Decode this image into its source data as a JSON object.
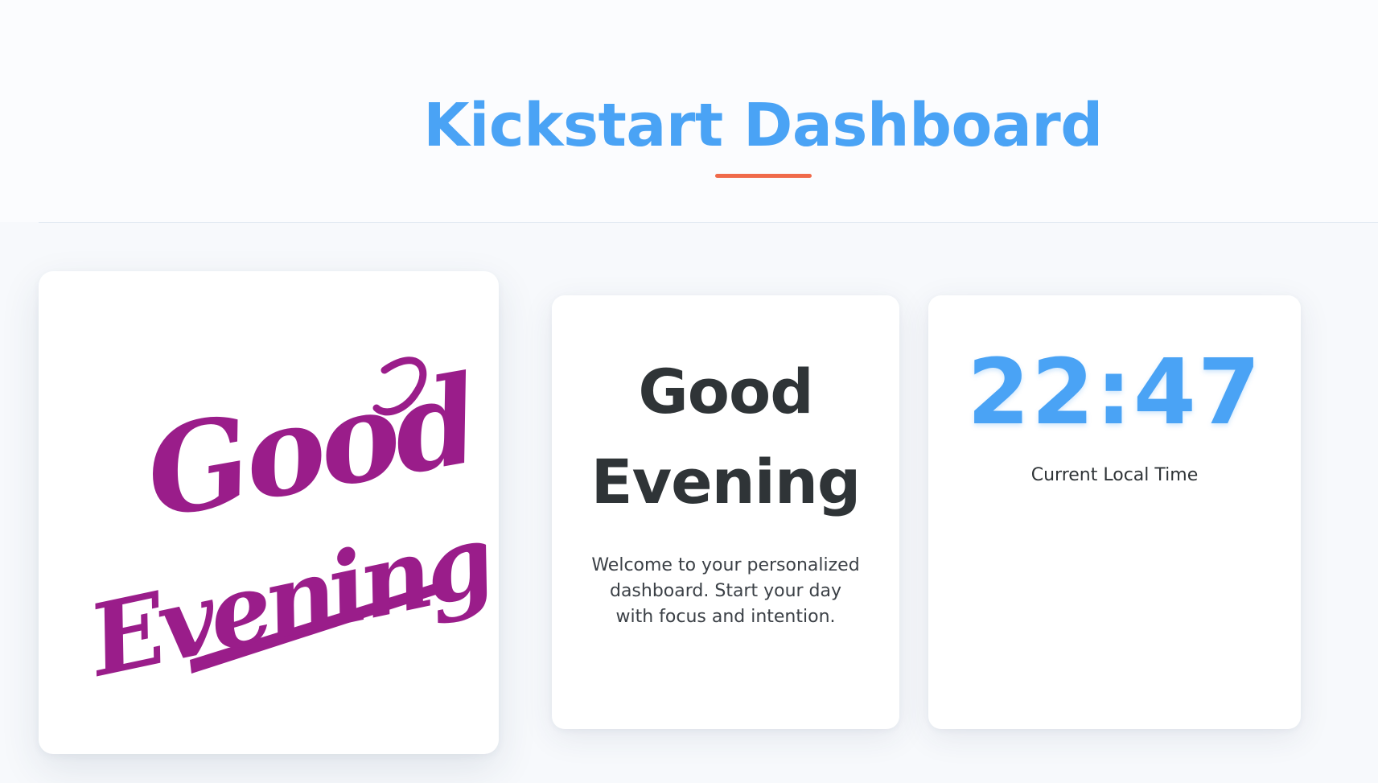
{
  "header": {
    "title": "Kickstart Dashboard"
  },
  "image_card": {
    "image_text_line1": "Good",
    "image_text_line2": "Evening",
    "image_color": "#9a1d8a"
  },
  "greeting_card": {
    "title": "Good Evening",
    "message": "Welcome to your personalized dashboard. Start your day with focus and intention."
  },
  "clock_card": {
    "time": "22:47",
    "label": "Current Local Time"
  },
  "colors": {
    "accent": "#4aa3f5",
    "underline": "#f06a4a",
    "text": "#2f3437",
    "background": "#f7f9fc"
  }
}
